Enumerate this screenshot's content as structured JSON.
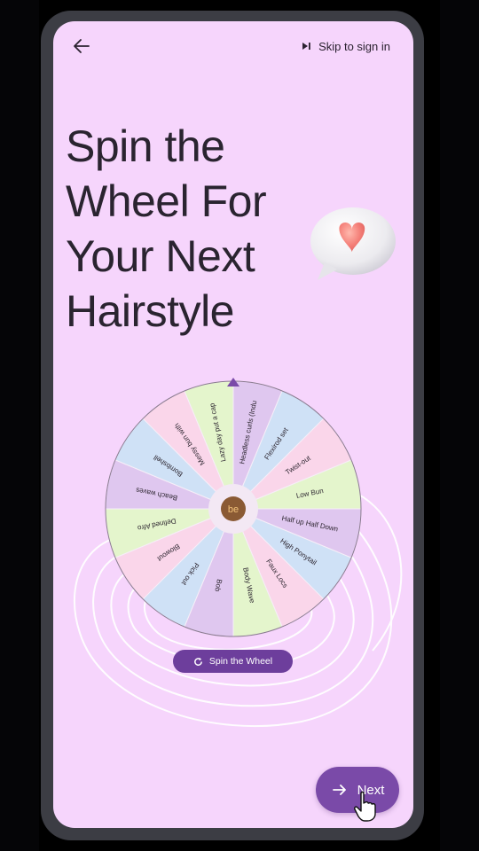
{
  "header": {
    "skip_label": "Skip to sign in"
  },
  "headline": {
    "lines": [
      "Spin the",
      "Wheel For",
      "Your Next",
      "Hairstyle"
    ]
  },
  "wheel": {
    "center_logo": "be",
    "segments": [
      {
        "label": "Headless curls (Indu",
        "color": "#dfc7ef"
      },
      {
        "label": "Flexirod set",
        "color": "#cfe1f6"
      },
      {
        "label": "Twist-out",
        "color": "#fad6ea"
      },
      {
        "label": "Low Bun",
        "color": "#e4f5cc"
      },
      {
        "label": "Half up Half Down",
        "color": "#dfc7ef"
      },
      {
        "label": "High Ponytail",
        "color": "#cfe1f6"
      },
      {
        "label": "Faux Locs",
        "color": "#fad6ea"
      },
      {
        "label": "Body Wave",
        "color": "#e4f5cc"
      },
      {
        "label": "Bob",
        "color": "#dfc7ef"
      },
      {
        "label": "Pick out",
        "color": "#cfe1f6"
      },
      {
        "label": "Blowout",
        "color": "#fad6ea"
      },
      {
        "label": "Defined Afro",
        "color": "#e4f5cc"
      },
      {
        "label": "Beach waves",
        "color": "#dfc7ef"
      },
      {
        "label": "Bombshell",
        "color": "#cfe1f6"
      },
      {
        "label": "Messy bun with",
        "color": "#fad6ea"
      },
      {
        "label": "Lazy day put a cap",
        "color": "#e4f5cc"
      }
    ]
  },
  "spin_button": {
    "label": "Spin the Wheel"
  },
  "next_button": {
    "label": "Next"
  },
  "colors": {
    "background": "#f6d5fc",
    "accent": "#7a4aa8",
    "pointer": "#7a4aa8"
  },
  "icons": {
    "back": "arrow-left-icon",
    "skip": "skip-next-icon",
    "spin": "refresh-icon",
    "next": "arrow-right-icon",
    "decoration": "heart-chat-bubble-icon"
  }
}
